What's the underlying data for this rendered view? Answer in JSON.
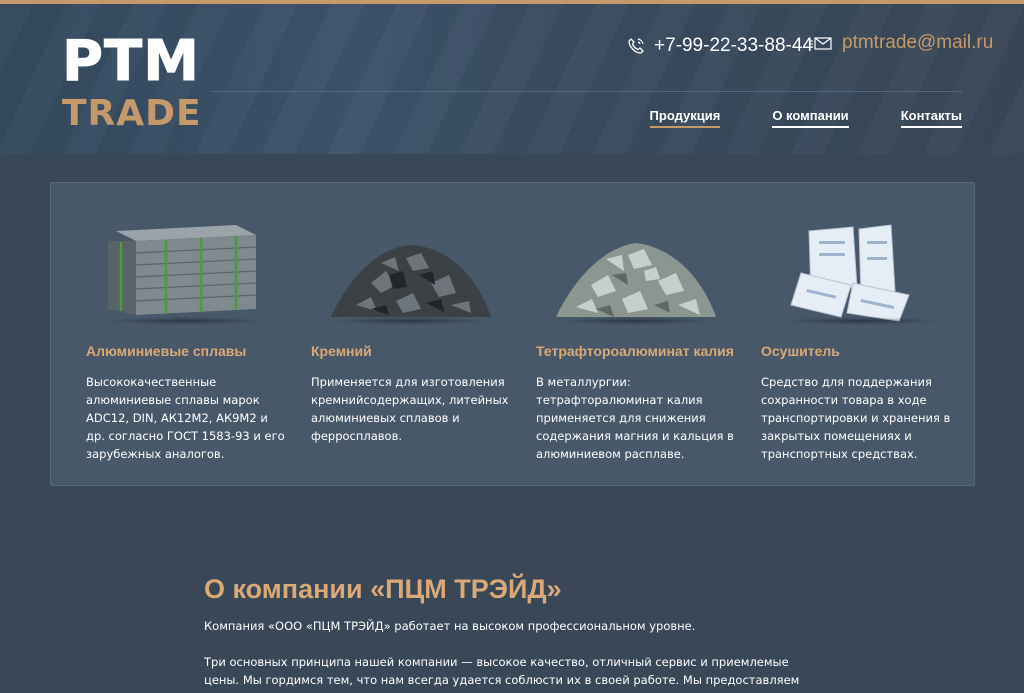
{
  "brand": {
    "logo_top": "PTM",
    "logo_bottom": "TRADE"
  },
  "contacts": {
    "phone": "+7-99-22-33-88-44",
    "email": "ptmtrade@mail.ru"
  },
  "nav": [
    {
      "label": "Продукция"
    },
    {
      "label": "О компании"
    },
    {
      "label": "Контакты"
    }
  ],
  "products": [
    {
      "title": "Алюминиевые сплавы",
      "desc": "Высококачественные алюминиевые сплавы  марок ADC12, DIN, АК12М2, АК9М2 и др. согласно ГОСТ 1583-93 и его зарубежных аналогов."
    },
    {
      "title": "Кремний",
      "desc": "Применяется для изготовления кремнийсодержащих, литейных алюминиевых сплавов и ферросплавов."
    },
    {
      "title": "Тетрафтороалюминат калия",
      "desc": "В металлургии: тетрафторалюминат калия применяется для снижения содержания магния и кальция в алюминиевом расплаве."
    },
    {
      "title": "Осушитель",
      "desc": "Средство для поддержания сохранности товара в ходе транспортировки и хранения в закрытых помещениях и транспортных средствах."
    }
  ],
  "about": {
    "title": "О компании «ПЦМ ТРЭЙД»",
    "p1": "Компания «ООО «ПЦМ ТРЭЙД» работает на высоком профессиональном уровне.",
    "p2": "Три основных принципа нашей компании — высокое качество, отличный сервис и приемлемые цены. Мы гордимся тем, что нам всегда удается соблюсти их в своей работе. Мы предоставляем товар высокого"
  },
  "colors": {
    "accent": "#c49a6c",
    "background": "#3a4757",
    "panel": "#485869"
  },
  "icons": {
    "phone": "phone-icon",
    "email": "envelope-icon"
  }
}
